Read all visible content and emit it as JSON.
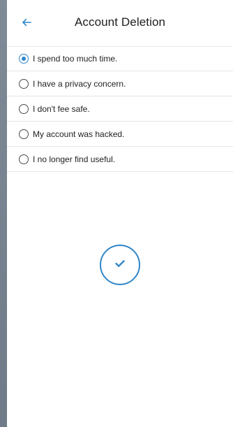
{
  "header": {
    "back_icon": "arrow-left-icon",
    "title": "Account Deletion"
  },
  "options": [
    {
      "label": "I spend too much time.",
      "selected": true
    },
    {
      "label": "I have a privacy concern.",
      "selected": false
    },
    {
      "label": "I don't fee safe.",
      "selected": false
    },
    {
      "label": "My account was hacked.",
      "selected": false
    },
    {
      "label": "I no longer find useful.",
      "selected": false
    }
  ],
  "confirm": {
    "icon": "checkmark-icon"
  },
  "colors": {
    "accent": "#2f86c9",
    "text": "#1f1f1f",
    "divider": "#e6e6e6",
    "background_outside": "#7f8a97"
  }
}
